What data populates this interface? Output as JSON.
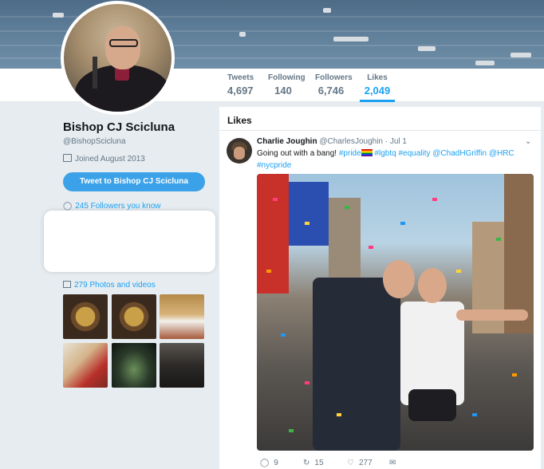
{
  "profile": {
    "name": "Bishop CJ Scicluna",
    "handle": "@BishopScicluna",
    "joined": "Joined August 2013",
    "tweet_button": "Tweet to Bishop CJ Scicluna",
    "followers_you_know": "245 Followers you know",
    "photos_videos": "279 Photos and videos"
  },
  "stats": [
    {
      "label": "Tweets",
      "value": "4,697"
    },
    {
      "label": "Following",
      "value": "140"
    },
    {
      "label": "Followers",
      "value": "6,746"
    },
    {
      "label": "Likes",
      "value": "2,049"
    }
  ],
  "likes": {
    "heading": "Likes",
    "tweet": {
      "author": "Charlie Joughin",
      "handle": "@CharlesJoughin",
      "time": "· Jul 1",
      "text_before": "Going out with a bang! ",
      "tag_pride": "#pride",
      "tags_rest": " #lgbtq #equality @ChadHGriffin @HRC",
      "tag_nyc": "#nycpride",
      "replies": "9",
      "retweets": "15",
      "likes": "277"
    }
  },
  "colors": {
    "accent": "#1da1f2",
    "background": "#e6ecf0",
    "muted": "#657786"
  }
}
